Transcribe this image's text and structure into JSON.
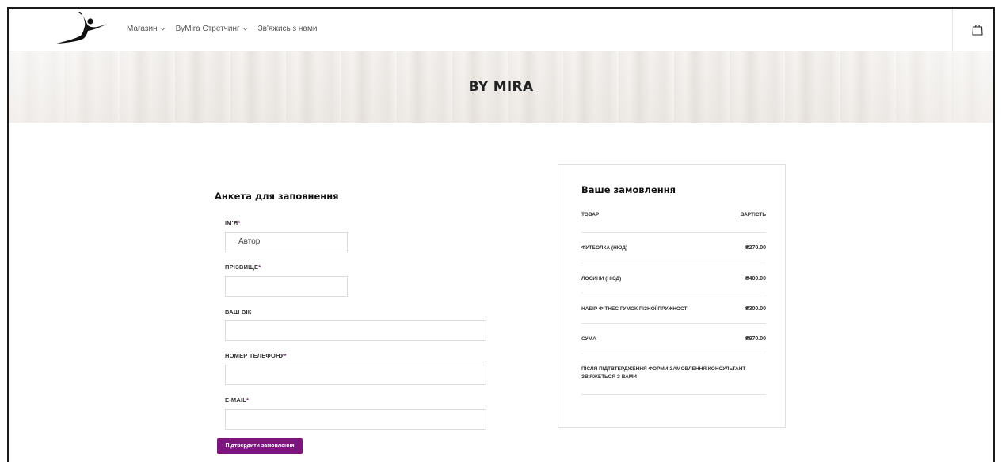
{
  "header": {
    "nav": [
      {
        "label": "Магазин",
        "has_dropdown": true
      },
      {
        "label": "ByMira Стретчинг",
        "has_dropdown": true
      },
      {
        "label": "Зв'яжись з нами",
        "has_dropdown": false
      }
    ],
    "cart_icon": "shopping-bag-icon"
  },
  "hero": {
    "title": "BY MIRA"
  },
  "form": {
    "title": "Анкета для заповнення",
    "fields": [
      {
        "label": "ІМ'Я",
        "required": true,
        "value": "Автор",
        "placeholder": ""
      },
      {
        "label": "ПРІЗВИЩЕ",
        "required": true,
        "value": "",
        "placeholder": ""
      },
      {
        "label": "ВАШ ВІК",
        "required": false,
        "value": "",
        "placeholder": ""
      },
      {
        "label": "НОМЕР ТЕЛЕФОНУ",
        "required": true,
        "value": "",
        "placeholder": ""
      },
      {
        "label": "E-MAIL",
        "required": true,
        "value": "",
        "placeholder": ""
      }
    ],
    "required_mark": "*",
    "submit_label": "Підтвердити замовлення"
  },
  "order": {
    "title": "Ваше замовлення",
    "col_product": "ТОВАР",
    "col_price": "ВАРТІСТЬ",
    "items": [
      {
        "name": "ФУТБОЛКА (НЮД)",
        "price": "₴270.00"
      },
      {
        "name": "ЛОСИНИ (НЮД)",
        "price": "₴400.00"
      },
      {
        "name": "НАБІР ФІТНЕС ГУМОК РІЗНОЇ ПРУЖНОСТІ",
        "price": "₴300.00"
      }
    ],
    "total_label": "СУМА",
    "total_value": "₴970.00",
    "note": "ПІСЛЯ ПІДТВТЕРДЖЕННЯ ФОРМИ ЗАМОВЛЕННЯ КОНСУЛЬТАНТ ЗВ'ЯЖЕТЬСЯ З ВАМИ"
  },
  "colors": {
    "accent": "#7d1480",
    "required": "#8b1a8b",
    "border": "#dcdcdc"
  }
}
